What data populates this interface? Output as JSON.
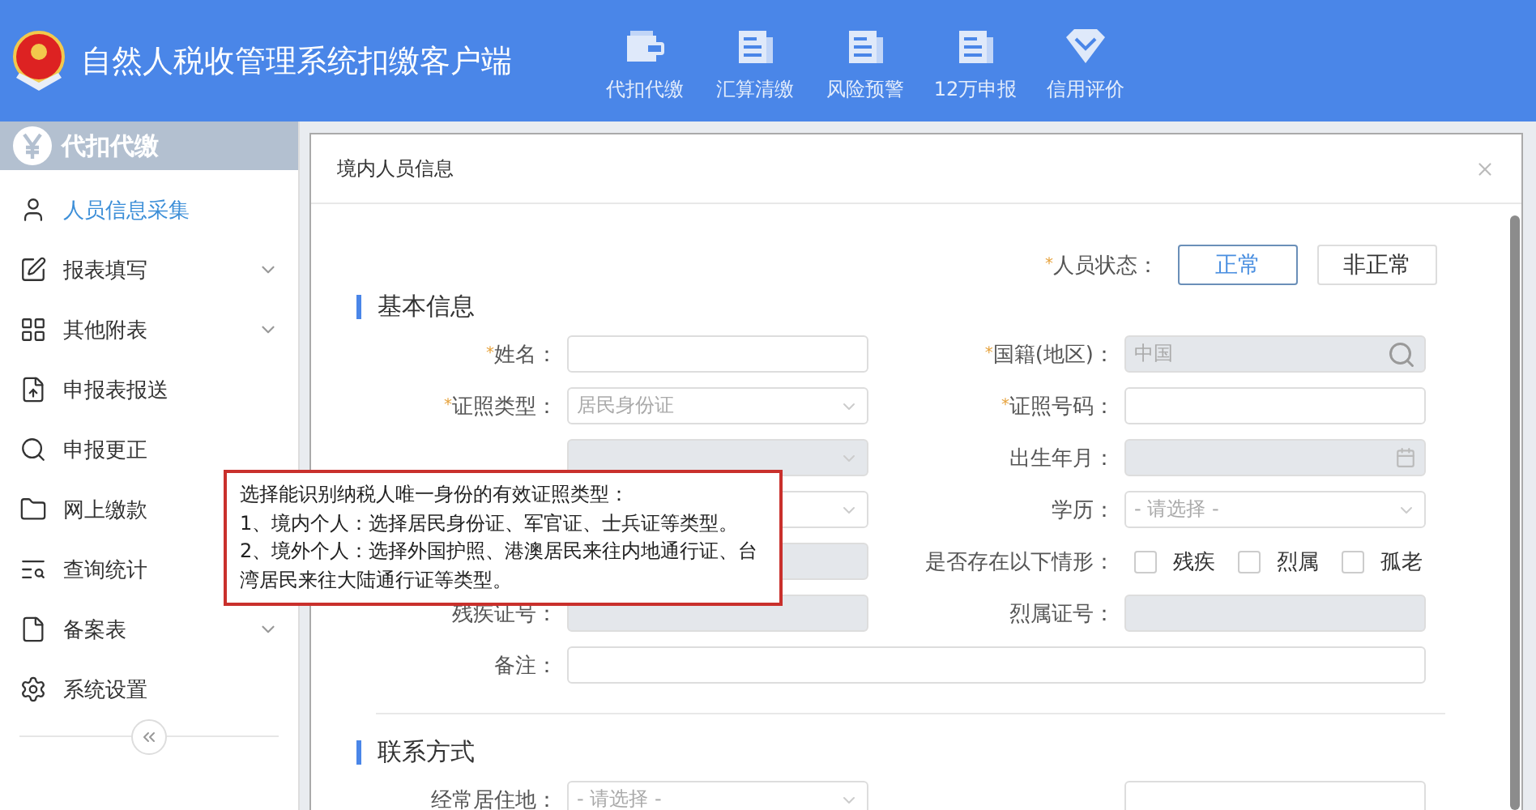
{
  "header": {
    "title": "自然人税收管理系统扣缴客户端",
    "nav": [
      {
        "label": "代扣代缴",
        "kind": "wallet"
      },
      {
        "label": "汇算清缴",
        "kind": "doc"
      },
      {
        "label": "风险预警",
        "kind": "doc"
      },
      {
        "label": "12万申报",
        "kind": "doc"
      },
      {
        "label": "信用评价",
        "kind": "diamond"
      }
    ]
  },
  "sidebar": {
    "title": "代扣代缴",
    "items": [
      {
        "label": "人员信息采集",
        "kind": "person",
        "selected": true,
        "has_children": false
      },
      {
        "label": "报表填写",
        "kind": "edit",
        "selected": false,
        "has_children": true
      },
      {
        "label": "其他附表",
        "kind": "grid",
        "selected": false,
        "has_children": true
      },
      {
        "label": "申报表报送",
        "kind": "upload",
        "selected": false,
        "has_children": false
      },
      {
        "label": "申报更正",
        "kind": "search",
        "selected": false,
        "has_children": false
      },
      {
        "label": "网上缴款",
        "kind": "folder",
        "selected": false,
        "has_children": false
      },
      {
        "label": "查询统计",
        "kind": "query",
        "selected": false,
        "has_children": false
      },
      {
        "label": "备案表",
        "kind": "file",
        "selected": false,
        "has_children": true
      },
      {
        "label": "系统设置",
        "kind": "gear",
        "selected": false,
        "has_children": false
      }
    ]
  },
  "modal": {
    "title": "境内人员信息",
    "status": {
      "label": "人员状态：",
      "required_mark": "*",
      "options": [
        {
          "label": "正常",
          "selected": true
        },
        {
          "label": "非正常",
          "selected": false
        }
      ]
    },
    "sections": [
      {
        "title": "基本信息",
        "fields": [
          {
            "label": "姓名：",
            "required_mark": "*",
            "kind": "text",
            "disabled": false
          },
          {
            "label": "国籍(地区)：",
            "required_mark": "*",
            "kind": "search",
            "disabled": true,
            "value": "中国"
          },
          {
            "label": "证照类型：",
            "required_mark": "*",
            "kind": "select",
            "disabled": false,
            "value": "居民身份证"
          },
          {
            "label": "证照号码：",
            "required_mark": "*",
            "kind": "text",
            "disabled": false
          },
          {
            "kind": "select",
            "disabled": true
          },
          {
            "label": "出生年月：",
            "kind": "date",
            "disabled": true
          },
          {
            "kind": "select",
            "disabled": false
          },
          {
            "label": "学历：",
            "kind": "select",
            "disabled": false,
            "placeholder": "- 请选择 -"
          },
          {
            "kind": "text",
            "disabled": true
          },
          {
            "label": "是否存在以下情形：",
            "kind": "checkboxes",
            "options": [
              {
                "label": "残疾",
                "checked": false
              },
              {
                "label": "烈属",
                "checked": false
              },
              {
                "label": "孤老",
                "checked": false
              }
            ]
          },
          {
            "label": "残疾证号：",
            "kind": "text",
            "disabled": true
          },
          {
            "label": "烈属证号：",
            "kind": "text",
            "disabled": true
          },
          {
            "label": "备注：",
            "kind": "wide",
            "disabled": false
          }
        ]
      },
      {
        "title": "联系方式",
        "fields": [
          {
            "label": "经常居住地：",
            "kind": "select",
            "disabled": false,
            "placeholder": "- 请选择 -"
          },
          {
            "kind": "text",
            "disabled": false
          }
        ]
      }
    ]
  },
  "tooltip": {
    "lines": [
      "选择能识别纳税人唯一身份的有效证照类型：",
      "1、境内个人：选择居民身份证、军官证、士兵证等类型。",
      "2、境外个人：选择外国护照、港澳居民来往内地通行证、台湾居民来往大陆通行证等类型。"
    ]
  }
}
